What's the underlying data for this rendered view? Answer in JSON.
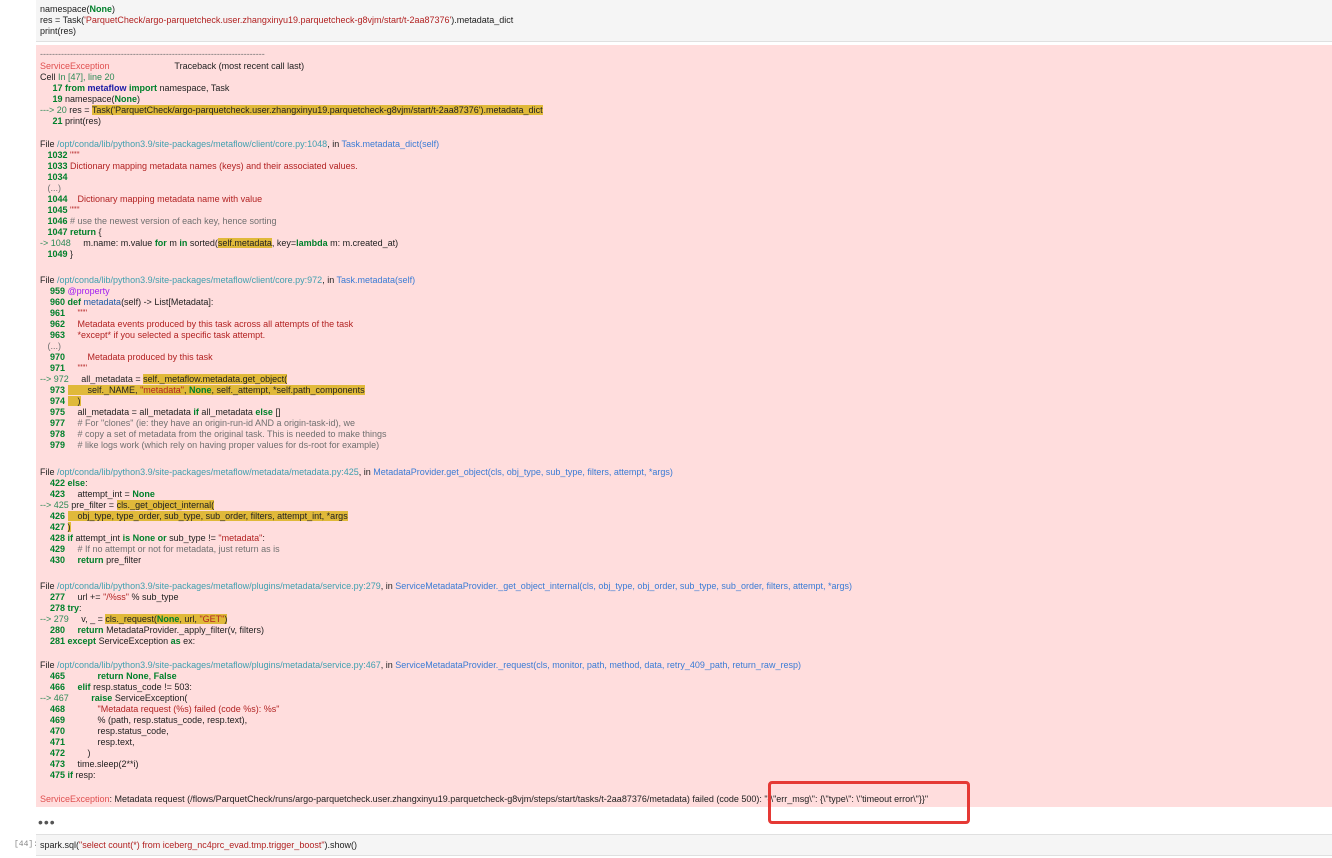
{
  "input_cell": {
    "line1_a": "namespace(",
    "line1_b": "None",
    "line1_c": ")",
    "line2_a": "res = Task(",
    "line2_b": "'ParquetCheck/argo-parquetcheck.user.zhangxinyu19.parquetcheck-g8vjm/start/t-2aa87376'",
    "line2_c": ").metadata_dict",
    "line3": "print(res)"
  },
  "traceback": {
    "dashes": "---------------------------------------------------------------------------",
    "exc_name": "ServiceException",
    "header": "Traceback (most recent call last)",
    "cell_a": "Cell ",
    "cell_b": "In [47], line 20",
    "l17a": "     17 ",
    "l17b": "from",
    "l17c": " metaflow ",
    "l17d": "import",
    "l17e": " namespace, Task",
    "l19a": "     19 ",
    "l19b": "namespace(",
    "l19c": "None",
    "l19d": ")",
    "l20a": "---> 20 ",
    "l20b": "res = ",
    "l20c": "Task('ParquetCheck/argo-parquetcheck.user.zhangxinyu19.parquetcheck-g8vjm/start/t-2aa87376').metadata_dict",
    "l21a": "     21 ",
    "l21b": "print(res)",
    "f1_a": "File ",
    "f1_b": "/opt/conda/lib/python3.9/site-packages/metaflow/client/core.py:1048",
    "f1_c": ", in ",
    "f1_d": "Task.metadata_dict(self)",
    "f1_1032a": "   1032 ",
    "f1_1032b": "\"\"\"",
    "f1_1033a": "   1033 ",
    "f1_1033b": "Dictionary mapping metadata names (keys) and their associated values.",
    "f1_1034a": "   1034 ",
    "f1_elide": "   (...)",
    "f1_1044a": "   1044 ",
    "f1_1044b": "   Dictionary mapping metadata name with value",
    "f1_1045a": "   1045 ",
    "f1_1045b": "\"\"\"",
    "f1_1046a": "   1046 ",
    "f1_1046b": "# use the newest version of each key, hence sorting",
    "f1_1047a": "   1047 ",
    "f1_1047b": "return",
    "f1_1047c": " {",
    "f1_1048a": "-> 1048 ",
    "f1_1048b": "    m.name: m.value ",
    "f1_1048c": "for",
    "f1_1048d": " m ",
    "f1_1048e": "in",
    "f1_1048f": " sorted(",
    "f1_1048g": "self.metadata",
    "f1_1048h": ", key=",
    "f1_1048i": "lambda",
    "f1_1048j": " m: m.created_at)",
    "f1_1049a": "   1049 ",
    "f1_1049b": "}",
    "f2_a": "File ",
    "f2_b": "/opt/conda/lib/python3.9/site-packages/metaflow/client/core.py:972",
    "f2_c": ", in ",
    "f2_d": "Task.metadata(self)",
    "f2_959a": "    959 ",
    "f2_959b": "@property",
    "f2_960a": "    960 ",
    "f2_960b": "def",
    "f2_960c": " metadata",
    "f2_960d": "(self) -> List[Metadata]:",
    "f2_961a": "    961 ",
    "f2_961b": "    \"\"\"",
    "f2_962a": "    962 ",
    "f2_962b": "    Metadata events produced by this task across all attempts of the task",
    "f2_963a": "    963 ",
    "f2_963b": "    *except* if you selected a specific task attempt.",
    "f2_elide": "   (...)",
    "f2_970a": "    970 ",
    "f2_970b": "        Metadata produced by this task",
    "f2_971a": "    971 ",
    "f2_971b": "    \"\"\"",
    "f2_972a": "--> 972 ",
    "f2_972b": "    all_metadata = ",
    "f2_972c": "self._metaflow.metadata.get_object(",
    "f2_973a": "    973 ",
    "f2_973b": "        self._NAME, ",
    "f2_973c": "\"metadata\"",
    "f2_973d": ", ",
    "f2_973e": "None",
    "f2_973f": ", self._attempt, *self.path_components",
    "f2_974a": "    974 ",
    "f2_974b": "    )",
    "f2_975a": "    975 ",
    "f2_975b": "    all_metadata = all_metadata ",
    "f2_975c": "if",
    "f2_975d": " all_metadata ",
    "f2_975e": "else",
    "f2_975f": " []",
    "f2_977a": "    977 ",
    "f2_977b": "    # For \"clones\" (ie: they have an origin-run-id AND a origin-task-id), we",
    "f2_978a": "    978 ",
    "f2_978b": "    # copy a set of metadata from the original task. This is needed to make things",
    "f2_979a": "    979 ",
    "f2_979b": "    # like logs work (which rely on having proper values for ds-root for example)",
    "f3_a": "File ",
    "f3_b": "/opt/conda/lib/python3.9/site-packages/metaflow/metadata/metadata.py:425",
    "f3_c": ", in ",
    "f3_d": "MetadataProvider.get_object(cls, obj_type, sub_type, filters, attempt, *args)",
    "f3_422a": "    422 ",
    "f3_422b": "else",
    "f3_422c": ":",
    "f3_423a": "    423 ",
    "f3_423b": "    attempt_int = ",
    "f3_423c": "None",
    "f3_425a": "--> 425 ",
    "f3_425b": "pre_filter = ",
    "f3_425c": "cls._get_object_internal(",
    "f3_426a": "    426 ",
    "f3_426b": "    obj_type, type_order, sub_type, sub_order, filters, attempt_int, *args",
    "f3_427a": "    427 ",
    "f3_427b": ")",
    "f3_428a": "    428 ",
    "f3_428b": "if",
    "f3_428c": " attempt_int ",
    "f3_428d": "is",
    "f3_428e": " ",
    "f3_428f": "None",
    "f3_428g": " ",
    "f3_428h": "or",
    "f3_428i": " sub_type != ",
    "f3_428j": "\"metadata\"",
    "f3_428k": ":",
    "f3_429a": "    429 ",
    "f3_429b": "    # If no attempt or not for metadata, just return as is",
    "f3_430a": "    430 ",
    "f3_430b": "    ",
    "f3_430c": "return",
    "f3_430d": " pre_filter",
    "f4_a": "File ",
    "f4_b": "/opt/conda/lib/python3.9/site-packages/metaflow/plugins/metadata/service.py:279",
    "f4_c": ", in ",
    "f4_d": "ServiceMetadataProvider._get_object_internal(cls, obj_type, obj_order, sub_type, sub_order, filters, attempt, *args)",
    "f4_277a": "    277 ",
    "f4_277b": "    url += ",
    "f4_277c": "\"/%ss\"",
    "f4_277d": " % sub_type",
    "f4_278a": "    278 ",
    "f4_278b": "try",
    "f4_278c": ":",
    "f4_279a": "--> 279 ",
    "f4_279b": "    v, _ = ",
    "f4_279c": "cls._request(",
    "f4_279d": "None",
    "f4_279e": ", url, ",
    "f4_279f": "\"GET\"",
    "f4_279g": ")",
    "f4_280a": "    280 ",
    "f4_280b": "    ",
    "f4_280c": "return",
    "f4_280d": " MetadataProvider._apply_filter(v, filters)",
    "f4_281a": "    281 ",
    "f4_281b": "except",
    "f4_281c": " ServiceException ",
    "f4_281d": "as",
    "f4_281e": " ex:",
    "f5_a": "File ",
    "f5_b": "/opt/conda/lib/python3.9/site-packages/metaflow/plugins/metadata/service.py:467",
    "f5_c": ", in ",
    "f5_d": "ServiceMetadataProvider._request(cls, monitor, path, method, data, retry_409_path, return_raw_resp)",
    "f5_465a": "    465 ",
    "f5_465b": "            ",
    "f5_465c": "return",
    "f5_465d": " ",
    "f5_465e": "None",
    "f5_465f": ", ",
    "f5_465g": "False",
    "f5_466a": "    466 ",
    "f5_466b": "    ",
    "f5_466c": "elif",
    "f5_466d": " resp.status_code != 503:",
    "f5_467a": "--> 467 ",
    "f5_467b": "        ",
    "f5_467c": "raise",
    "f5_467d": " ServiceException(",
    "f5_468a": "    468 ",
    "f5_468b": "            \"Metadata request (%s) failed (code %s): %s\"",
    "f5_469a": "    469 ",
    "f5_469b": "            % (path, resp.status_code, resp.text),",
    "f5_470a": "    470 ",
    "f5_470b": "            resp.status_code,",
    "f5_471a": "    471 ",
    "f5_471b": "            resp.text,",
    "f5_472a": "    472 ",
    "f5_472b": "        )",
    "f5_473a": "    473 ",
    "f5_473b": "    time.sleep(2**i)",
    "f5_475a": "    475 ",
    "f5_475b": "if",
    "f5_475c": " resp:",
    "final_a": "ServiceException",
    "final_b": ": Metadata request (/flows/ParquetCheck/runs/argo-parquetcheck.user.zhangxinyu19.parquetcheck-g8vjm/steps/start/tasks/t-2aa87376/metadata) failed (code 500): \"{\\\"err_msg\\\": {\\\"type\\\": \\\"timeout error\\\"}}\""
  },
  "ellipsis": "•••",
  "next_cell": {
    "prompt": "[44]:",
    "code_a": "spark.sql(",
    "code_b": "\"select count(*) from iceberg_nc4prc_evad.tmp.trigger_boost\"",
    "code_c": ").show()"
  },
  "colors": {
    "error_bg": "#ffdddd",
    "highlight": "#e0b93a",
    "annotation_box": "#e53935"
  }
}
